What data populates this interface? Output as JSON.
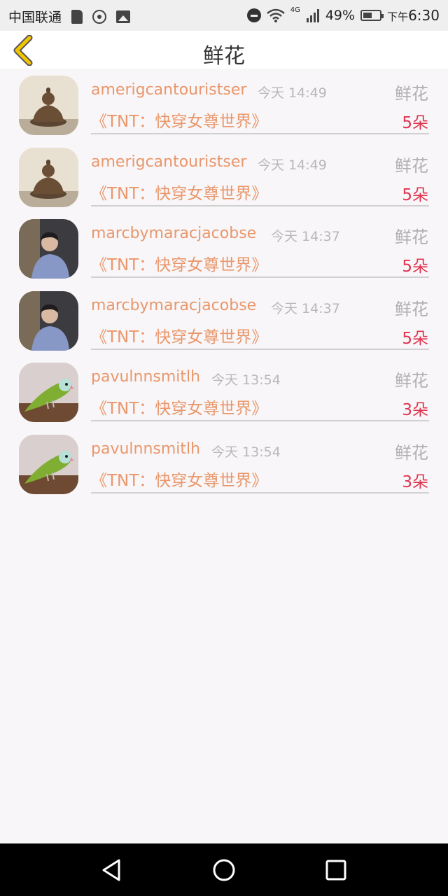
{
  "status_bar": {
    "carrier": "中国联通",
    "battery": "49%",
    "time_prefix": "下午",
    "time": "6:30",
    "network": "4G",
    "icons": [
      "sd-card-icon",
      "hotspot-icon",
      "image-icon",
      "do-not-disturb-icon",
      "wifi-icon",
      "signal-icon",
      "battery-icon"
    ]
  },
  "header": {
    "title": "鲜花",
    "back_icon": "chevron-left-icon"
  },
  "rows": [
    {
      "user": "amerigcantouristser",
      "time": "今天 14:49",
      "gift": "鲜花",
      "book": "《TNT：快穿女尊世界》",
      "qty": "5朵",
      "avatar": "buddha-avatar"
    },
    {
      "user": "amerigcantouristser",
      "time": "今天 14:49",
      "gift": "鲜花",
      "book": "《TNT：快穿女尊世界》",
      "qty": "5朵",
      "avatar": "buddha-avatar"
    },
    {
      "user": "marcbymaracjacobse",
      "time": "今天 14:37",
      "gift": "鲜花",
      "book": "《TNT：快穿女尊世界》",
      "qty": "5朵",
      "avatar": "person-avatar"
    },
    {
      "user": "marcbymaracjacobse",
      "time": "今天 14:37",
      "gift": "鲜花",
      "book": "《TNT：快穿女尊世界》",
      "qty": "5朵",
      "avatar": "person-avatar"
    },
    {
      "user": "pavulnnsmitlh",
      "time": "今天 13:54",
      "gift": "鲜花",
      "book": "《TNT：快穿女尊世界》",
      "qty": "3朵",
      "avatar": "parrot-avatar"
    },
    {
      "user": "pavulnnsmitlh",
      "time": "今天 13:54",
      "gift": "鲜花",
      "book": "《TNT：快穿女尊世界》",
      "qty": "3朵",
      "avatar": "parrot-avatar"
    }
  ],
  "nav_bar": {
    "icons": [
      "nav-back-icon",
      "nav-home-icon",
      "nav-recents-icon"
    ]
  },
  "colors": {
    "accent": "#e9976b",
    "quantity": "#e0344f",
    "muted": "#b8b8b8",
    "back_chevron": "#f2c400"
  }
}
